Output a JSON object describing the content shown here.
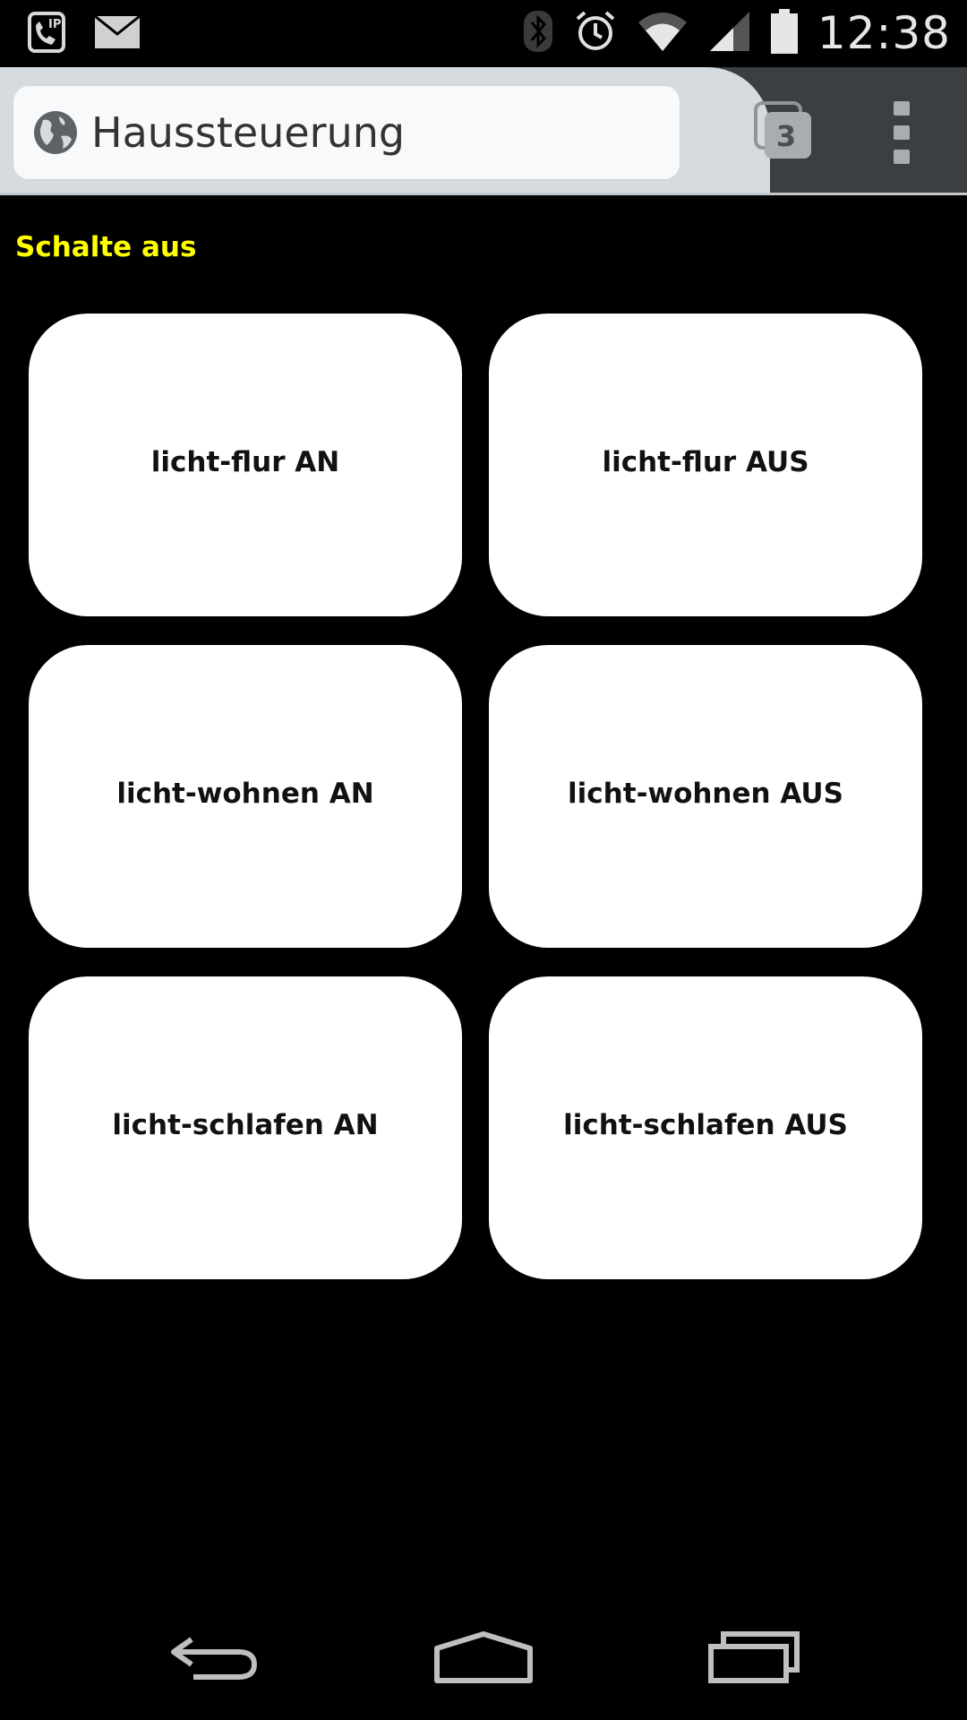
{
  "status_bar": {
    "time": "12:38",
    "left_icons": [
      "sip-call-icon",
      "mail-icon"
    ],
    "right_icons": [
      "bluetooth-icon",
      "alarm-icon",
      "wifi-icon",
      "signal-icon",
      "battery-icon"
    ]
  },
  "browser": {
    "url_text": "Haussteuerung",
    "tab_count": "3",
    "toolbar_color": "#3b3f42",
    "tab_color": "#d6dbe0"
  },
  "page": {
    "heading": "Schalte aus",
    "heading_color": "#ffff00",
    "buttons": [
      {
        "label": "licht-flur AN"
      },
      {
        "label": "licht-flur AUS"
      },
      {
        "label": "licht-wohnen AN"
      },
      {
        "label": "licht-wohnen AUS"
      },
      {
        "label": "licht-schlafen AN"
      },
      {
        "label": "licht-schlafen AUS"
      }
    ]
  },
  "nav_bar": {
    "buttons": [
      "back-icon",
      "home-icon",
      "recent-apps-icon"
    ]
  }
}
